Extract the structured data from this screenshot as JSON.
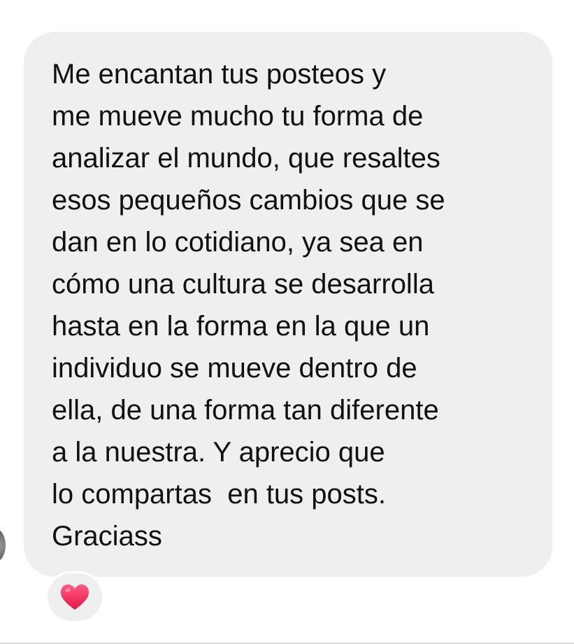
{
  "message": {
    "lines": [
      "Me encantan tus posteos y",
      "me mueve mucho tu forma de",
      "analizar el mundo, que resaltes",
      "esos pequeños cambios que se",
      "dan en lo cotidiano, ya sea en",
      "cómo una cultura se desarrolla",
      "hasta en la forma en la que un",
      "individuo se mueve dentro de",
      "ella, de una forma tan diferente",
      "a la nuestra. Y aprecio que",
      "lo compartas  en tus posts.",
      "Graciass"
    ],
    "bubble_color": "#efefef",
    "text_color": "#111111"
  },
  "reaction": {
    "icon": "heart-icon",
    "color": "#ff2e63"
  },
  "sender": {
    "icon": "avatar"
  }
}
